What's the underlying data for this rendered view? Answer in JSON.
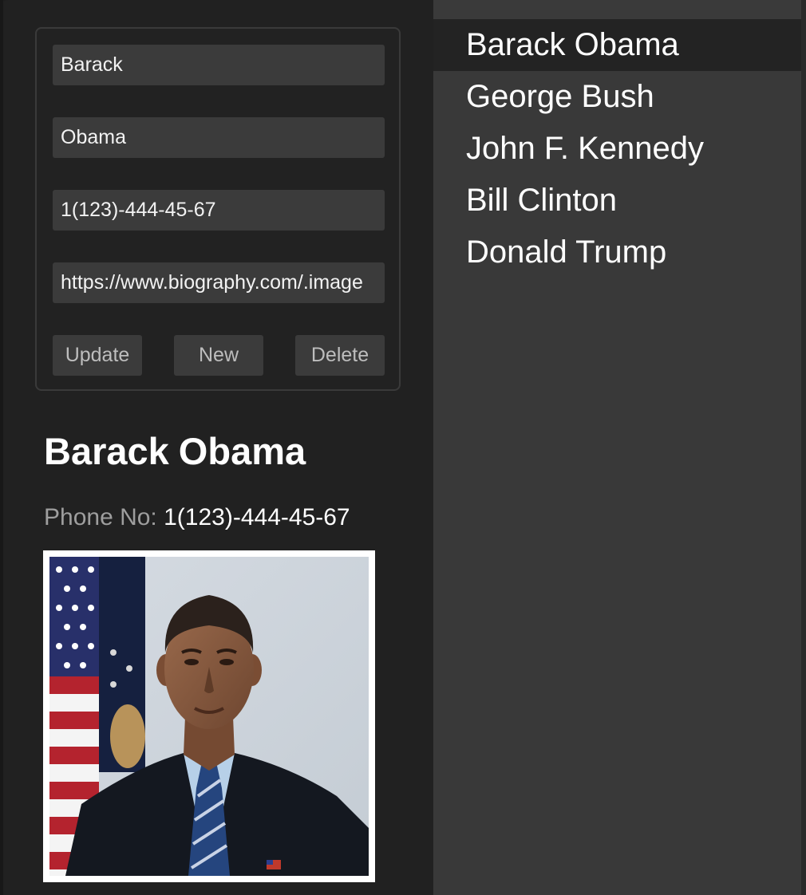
{
  "form": {
    "first_name": "Barack",
    "last_name": "Obama",
    "phone": "1(123)-444-45-67",
    "image_url": "https://www.biography.com/.image",
    "buttons": {
      "update": "Update",
      "new": "New",
      "delete": "Delete"
    }
  },
  "detail": {
    "first_name": "Barack",
    "last_name": "Obama",
    "phone_label": "Phone No:",
    "phone_value": "1(123)-444-45-67",
    "photo_icon": "portrait-photo"
  },
  "contacts": [
    {
      "name": "Barack Obama",
      "selected": true
    },
    {
      "name": "George Bush",
      "selected": false
    },
    {
      "name": "John F. Kennedy",
      "selected": false
    },
    {
      "name": "Bill Clinton",
      "selected": false
    },
    {
      "name": "Donald Trump",
      "selected": false
    }
  ],
  "colors": {
    "left_panel": "#212121",
    "right_panel": "#393939",
    "field_bg": "#3b3b3b",
    "selected_row": "#232323"
  }
}
